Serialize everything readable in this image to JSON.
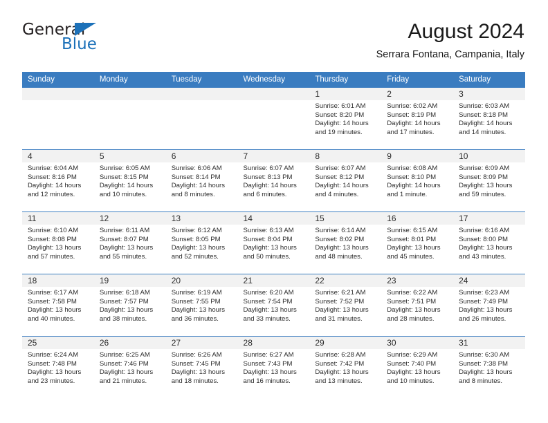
{
  "brand": {
    "name_top": "General",
    "name_bottom": "Blue",
    "accent_color": "#1c71b9"
  },
  "header": {
    "month_title": "August 2024",
    "location": "Serrara Fontana, Campania, Italy",
    "header_bg": "#3a7cc0"
  },
  "weekday_headers": [
    "Sunday",
    "Monday",
    "Tuesday",
    "Wednesday",
    "Thursday",
    "Friday",
    "Saturday"
  ],
  "weeks": [
    [
      {
        "day": "",
        "sunrise": "",
        "sunset": "",
        "daylight_line1": "",
        "daylight_line2": ""
      },
      {
        "day": "",
        "sunrise": "",
        "sunset": "",
        "daylight_line1": "",
        "daylight_line2": ""
      },
      {
        "day": "",
        "sunrise": "",
        "sunset": "",
        "daylight_line1": "",
        "daylight_line2": ""
      },
      {
        "day": "",
        "sunrise": "",
        "sunset": "",
        "daylight_line1": "",
        "daylight_line2": ""
      },
      {
        "day": "1",
        "sunrise": "Sunrise: 6:01 AM",
        "sunset": "Sunset: 8:20 PM",
        "daylight_line1": "Daylight: 14 hours",
        "daylight_line2": "and 19 minutes."
      },
      {
        "day": "2",
        "sunrise": "Sunrise: 6:02 AM",
        "sunset": "Sunset: 8:19 PM",
        "daylight_line1": "Daylight: 14 hours",
        "daylight_line2": "and 17 minutes."
      },
      {
        "day": "3",
        "sunrise": "Sunrise: 6:03 AM",
        "sunset": "Sunset: 8:18 PM",
        "daylight_line1": "Daylight: 14 hours",
        "daylight_line2": "and 14 minutes."
      }
    ],
    [
      {
        "day": "4",
        "sunrise": "Sunrise: 6:04 AM",
        "sunset": "Sunset: 8:16 PM",
        "daylight_line1": "Daylight: 14 hours",
        "daylight_line2": "and 12 minutes."
      },
      {
        "day": "5",
        "sunrise": "Sunrise: 6:05 AM",
        "sunset": "Sunset: 8:15 PM",
        "daylight_line1": "Daylight: 14 hours",
        "daylight_line2": "and 10 minutes."
      },
      {
        "day": "6",
        "sunrise": "Sunrise: 6:06 AM",
        "sunset": "Sunset: 8:14 PM",
        "daylight_line1": "Daylight: 14 hours",
        "daylight_line2": "and 8 minutes."
      },
      {
        "day": "7",
        "sunrise": "Sunrise: 6:07 AM",
        "sunset": "Sunset: 8:13 PM",
        "daylight_line1": "Daylight: 14 hours",
        "daylight_line2": "and 6 minutes."
      },
      {
        "day": "8",
        "sunrise": "Sunrise: 6:07 AM",
        "sunset": "Sunset: 8:12 PM",
        "daylight_line1": "Daylight: 14 hours",
        "daylight_line2": "and 4 minutes."
      },
      {
        "day": "9",
        "sunrise": "Sunrise: 6:08 AM",
        "sunset": "Sunset: 8:10 PM",
        "daylight_line1": "Daylight: 14 hours",
        "daylight_line2": "and 1 minute."
      },
      {
        "day": "10",
        "sunrise": "Sunrise: 6:09 AM",
        "sunset": "Sunset: 8:09 PM",
        "daylight_line1": "Daylight: 13 hours",
        "daylight_line2": "and 59 minutes."
      }
    ],
    [
      {
        "day": "11",
        "sunrise": "Sunrise: 6:10 AM",
        "sunset": "Sunset: 8:08 PM",
        "daylight_line1": "Daylight: 13 hours",
        "daylight_line2": "and 57 minutes."
      },
      {
        "day": "12",
        "sunrise": "Sunrise: 6:11 AM",
        "sunset": "Sunset: 8:07 PM",
        "daylight_line1": "Daylight: 13 hours",
        "daylight_line2": "and 55 minutes."
      },
      {
        "day": "13",
        "sunrise": "Sunrise: 6:12 AM",
        "sunset": "Sunset: 8:05 PM",
        "daylight_line1": "Daylight: 13 hours",
        "daylight_line2": "and 52 minutes."
      },
      {
        "day": "14",
        "sunrise": "Sunrise: 6:13 AM",
        "sunset": "Sunset: 8:04 PM",
        "daylight_line1": "Daylight: 13 hours",
        "daylight_line2": "and 50 minutes."
      },
      {
        "day": "15",
        "sunrise": "Sunrise: 6:14 AM",
        "sunset": "Sunset: 8:02 PM",
        "daylight_line1": "Daylight: 13 hours",
        "daylight_line2": "and 48 minutes."
      },
      {
        "day": "16",
        "sunrise": "Sunrise: 6:15 AM",
        "sunset": "Sunset: 8:01 PM",
        "daylight_line1": "Daylight: 13 hours",
        "daylight_line2": "and 45 minutes."
      },
      {
        "day": "17",
        "sunrise": "Sunrise: 6:16 AM",
        "sunset": "Sunset: 8:00 PM",
        "daylight_line1": "Daylight: 13 hours",
        "daylight_line2": "and 43 minutes."
      }
    ],
    [
      {
        "day": "18",
        "sunrise": "Sunrise: 6:17 AM",
        "sunset": "Sunset: 7:58 PM",
        "daylight_line1": "Daylight: 13 hours",
        "daylight_line2": "and 40 minutes."
      },
      {
        "day": "19",
        "sunrise": "Sunrise: 6:18 AM",
        "sunset": "Sunset: 7:57 PM",
        "daylight_line1": "Daylight: 13 hours",
        "daylight_line2": "and 38 minutes."
      },
      {
        "day": "20",
        "sunrise": "Sunrise: 6:19 AM",
        "sunset": "Sunset: 7:55 PM",
        "daylight_line1": "Daylight: 13 hours",
        "daylight_line2": "and 36 minutes."
      },
      {
        "day": "21",
        "sunrise": "Sunrise: 6:20 AM",
        "sunset": "Sunset: 7:54 PM",
        "daylight_line1": "Daylight: 13 hours",
        "daylight_line2": "and 33 minutes."
      },
      {
        "day": "22",
        "sunrise": "Sunrise: 6:21 AM",
        "sunset": "Sunset: 7:52 PM",
        "daylight_line1": "Daylight: 13 hours",
        "daylight_line2": "and 31 minutes."
      },
      {
        "day": "23",
        "sunrise": "Sunrise: 6:22 AM",
        "sunset": "Sunset: 7:51 PM",
        "daylight_line1": "Daylight: 13 hours",
        "daylight_line2": "and 28 minutes."
      },
      {
        "day": "24",
        "sunrise": "Sunrise: 6:23 AM",
        "sunset": "Sunset: 7:49 PM",
        "daylight_line1": "Daylight: 13 hours",
        "daylight_line2": "and 26 minutes."
      }
    ],
    [
      {
        "day": "25",
        "sunrise": "Sunrise: 6:24 AM",
        "sunset": "Sunset: 7:48 PM",
        "daylight_line1": "Daylight: 13 hours",
        "daylight_line2": "and 23 minutes."
      },
      {
        "day": "26",
        "sunrise": "Sunrise: 6:25 AM",
        "sunset": "Sunset: 7:46 PM",
        "daylight_line1": "Daylight: 13 hours",
        "daylight_line2": "and 21 minutes."
      },
      {
        "day": "27",
        "sunrise": "Sunrise: 6:26 AM",
        "sunset": "Sunset: 7:45 PM",
        "daylight_line1": "Daylight: 13 hours",
        "daylight_line2": "and 18 minutes."
      },
      {
        "day": "28",
        "sunrise": "Sunrise: 6:27 AM",
        "sunset": "Sunset: 7:43 PM",
        "daylight_line1": "Daylight: 13 hours",
        "daylight_line2": "and 16 minutes."
      },
      {
        "day": "29",
        "sunrise": "Sunrise: 6:28 AM",
        "sunset": "Sunset: 7:42 PM",
        "daylight_line1": "Daylight: 13 hours",
        "daylight_line2": "and 13 minutes."
      },
      {
        "day": "30",
        "sunrise": "Sunrise: 6:29 AM",
        "sunset": "Sunset: 7:40 PM",
        "daylight_line1": "Daylight: 13 hours",
        "daylight_line2": "and 10 minutes."
      },
      {
        "day": "31",
        "sunrise": "Sunrise: 6:30 AM",
        "sunset": "Sunset: 7:38 PM",
        "daylight_line1": "Daylight: 13 hours",
        "daylight_line2": "and 8 minutes."
      }
    ]
  ]
}
